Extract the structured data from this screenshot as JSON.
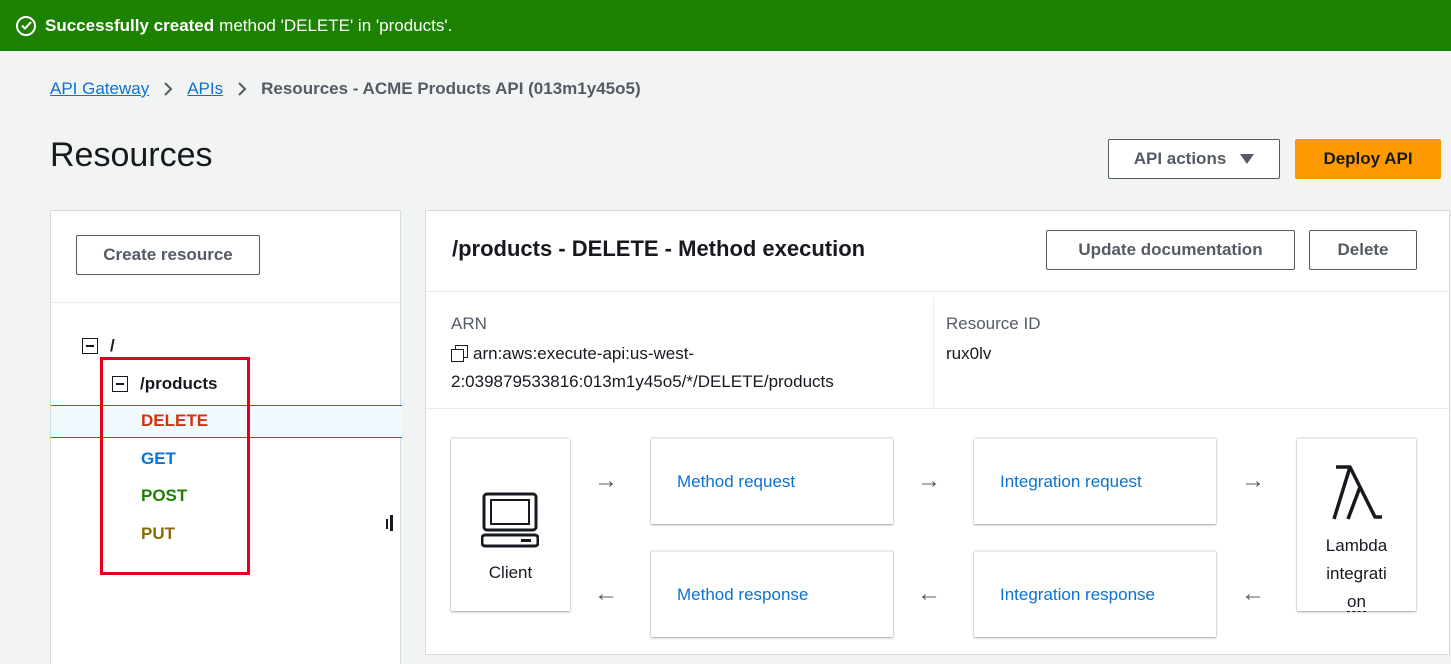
{
  "flash": {
    "bold": "Successfully created",
    "message": "method 'DELETE' in 'products'."
  },
  "breadcrumb": {
    "items": [
      "API Gateway",
      "APIs"
    ],
    "current": "Resources - ACME Products API (013m1y45o5)"
  },
  "page": {
    "title": "Resources"
  },
  "header_actions": {
    "api_actions": "API actions",
    "deploy": "Deploy API"
  },
  "sidebar": {
    "create_button": "Create resource",
    "root": "/",
    "resource": "/products",
    "methods": [
      "DELETE",
      "GET",
      "POST",
      "PUT"
    ],
    "selected": "DELETE"
  },
  "panel": {
    "title": "/products - DELETE - Method execution",
    "update_doc": "Update documentation",
    "delete": "Delete",
    "arn_label": "ARN",
    "arn_line1": "arn:aws:execute-api:us-west-",
    "arn_line2": "2:039879533816:013m1y45o5/*/DELETE/products",
    "resource_id_label": "Resource ID",
    "resource_id": "rux0lv"
  },
  "flow": {
    "client": "Client",
    "method_request": "Method request",
    "integration_request": "Integration request",
    "method_response": "Method response",
    "integration_response": "Integration response",
    "lambda_line1": "Lambda",
    "lambda_line2": "integrati",
    "lambda_line3": "on"
  },
  "colors": {
    "success": "#1d8102",
    "accent": "#0972d3",
    "deploy": "#ff9900",
    "highlight": "#e0001b"
  }
}
